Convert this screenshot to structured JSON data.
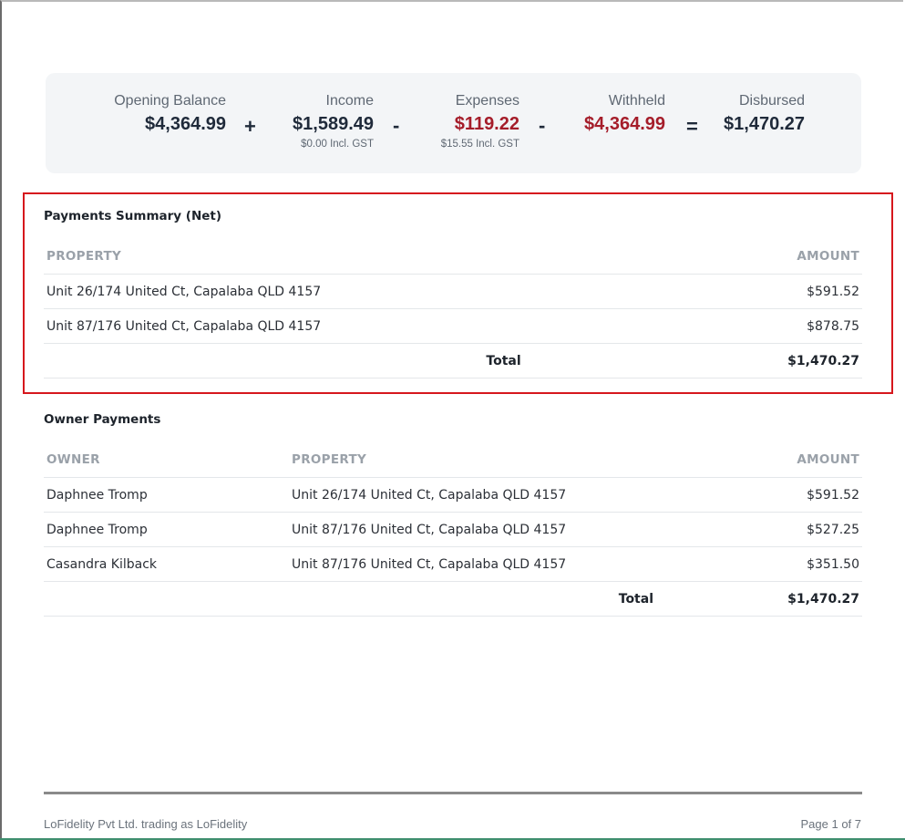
{
  "summary": {
    "opening_balance": {
      "label": "Opening Balance",
      "value": "$4,364.99"
    },
    "income": {
      "label": "Income",
      "value": "$1,589.49",
      "sub": "$0.00 Incl. GST"
    },
    "expenses": {
      "label": "Expenses",
      "value": "$119.22",
      "sub": "$15.55 Incl. GST"
    },
    "withheld": {
      "label": "Withheld",
      "value": "$4,364.99"
    },
    "disbursed": {
      "label": "Disbursed",
      "value": "$1,470.27"
    },
    "ops": {
      "plus": "+",
      "minus1": "-",
      "minus2": "-",
      "equals": "="
    },
    "colors": {
      "negative": "#a51d2a",
      "default": "#1f2a3a"
    }
  },
  "payments_summary": {
    "title": "Payments Summary (Net)",
    "headers": {
      "property": "PROPERTY",
      "amount": "AMOUNT"
    },
    "rows": [
      {
        "property": "Unit 26/174 United Ct, Capalaba QLD 4157",
        "amount": "$591.52"
      },
      {
        "property": "Unit 87/176 United Ct, Capalaba QLD 4157",
        "amount": "$878.75"
      }
    ],
    "total_label": "Total",
    "total_value": "$1,470.27"
  },
  "owner_payments": {
    "title": "Owner Payments",
    "headers": {
      "owner": "OWNER",
      "property": "PROPERTY",
      "amount": "AMOUNT"
    },
    "rows": [
      {
        "owner": "Daphnee Tromp",
        "property": "Unit 26/174 United Ct, Capalaba QLD 4157",
        "amount": "$591.52"
      },
      {
        "owner": "Daphnee Tromp",
        "property": "Unit 87/176 United Ct, Capalaba QLD 4157",
        "amount": "$527.25"
      },
      {
        "owner": "Casandra Kilback",
        "property": "Unit 87/176 United Ct, Capalaba QLD 4157",
        "amount": "$351.50"
      }
    ],
    "total_label": "Total",
    "total_value": "$1,470.27"
  },
  "footer": {
    "company": "LoFidelity Pvt Ltd. trading as LoFidelity",
    "page": "Page 1 of 7"
  }
}
